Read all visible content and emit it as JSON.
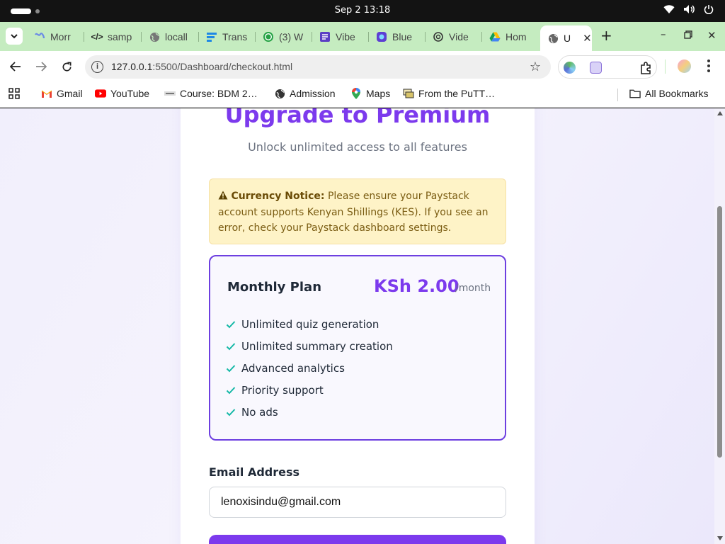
{
  "os": {
    "clock": "Sep 2  13:18",
    "tray_icons": [
      "wifi-icon",
      "volume-icon",
      "power-icon"
    ]
  },
  "tabs": [
    {
      "label": "Morr",
      "icon": "morphic-icon"
    },
    {
      "label": "samp",
      "icon": "code-icon"
    },
    {
      "label": "locall",
      "icon": "globe-icon"
    },
    {
      "label": "Trans",
      "icon": "lines-icon"
    },
    {
      "label": "(3) W",
      "icon": "whatsapp-icon"
    },
    {
      "label": "Vibe",
      "icon": "vibe-icon"
    },
    {
      "label": "Blue",
      "icon": "bluesky-icon"
    },
    {
      "label": "Vide",
      "icon": "openai-icon"
    },
    {
      "label": "Hom",
      "icon": "drive-icon"
    },
    {
      "label": "U",
      "icon": "globe-icon",
      "active": true
    }
  ],
  "toolbar": {
    "url_host": "127.0.0.1",
    "url_path": ":5500/Dashboard/checkout.html"
  },
  "bookmarks": [
    {
      "label": "Gmail",
      "icon": "gmail-icon"
    },
    {
      "label": "YouTube",
      "icon": "youtube-icon"
    },
    {
      "label": "Course: BDM 2…",
      "icon": "course-icon"
    },
    {
      "label": "Admission",
      "icon": "globe-icon"
    },
    {
      "label": "Maps",
      "icon": "maps-icon"
    },
    {
      "label": "From the PuTT…",
      "icon": "putty-icon"
    }
  ],
  "all_bookmarks": "All Bookmarks",
  "page": {
    "title": "Upgrade to Premium",
    "subtitle": "Unlock unlimited access to all features",
    "notice": {
      "icon": "warning-icon",
      "heading": "Currency Notice:",
      "text": "Please ensure your Paystack account supports Kenyan Shillings (KES). If you see an error, check your Paystack dashboard settings."
    },
    "plan": {
      "name": "Monthly Plan",
      "price": "KSh 2.00",
      "period": "/month",
      "features": [
        "Unlimited quiz generation",
        "Unlimited summary creation",
        "Advanced analytics",
        "Priority support",
        "No ads"
      ]
    },
    "email": {
      "label": "Email Address",
      "value": "lenoxisindu@gmail.com"
    }
  },
  "colors": {
    "accent": "#7c3aed",
    "check": "#14b8a6",
    "notice_bg": "#fef3c7",
    "tabstrip": "#c5ecc0"
  }
}
